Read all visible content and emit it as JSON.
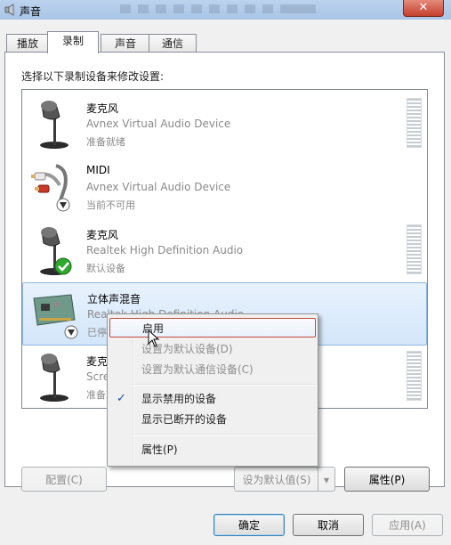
{
  "window": {
    "title": "声音",
    "close_glyph": "✕",
    "colors": {
      "title_bar": "#bcd3ee",
      "close_button": "#c4402d",
      "selection": "#d3e6fa",
      "menu_hover_border": "#c64a3a"
    }
  },
  "tabs": [
    {
      "label": "播放",
      "active": false
    },
    {
      "label": "录制",
      "active": true
    },
    {
      "label": "声音",
      "active": false
    },
    {
      "label": "通信",
      "active": false
    }
  ],
  "instruction": "选择以下录制设备来修改设置:",
  "devices": [
    {
      "name": "麦克风",
      "description": "Avnex Virtual Audio Device",
      "status": "准备就绪",
      "icon": "microphone-icon",
      "badge": ""
    },
    {
      "name": "MIDI",
      "description": "Avnex Virtual Audio Device",
      "status": "当前不可用",
      "icon": "audio-jack-icon",
      "badge": "down-arrow-badge"
    },
    {
      "name": "麦克风",
      "description": "Realtek High Definition Audio",
      "status": "默认设备",
      "icon": "microphone-icon",
      "badge": "default-check-badge"
    },
    {
      "name": "立体声混音",
      "description": "Realtek High Definition Audio",
      "status": "已停用",
      "icon": "sound-card-icon",
      "badge": "down-arrow-badge"
    },
    {
      "name": "麦克风",
      "description": "Screen Capture Audio",
      "status": "准备就绪",
      "icon": "microphone-icon",
      "badge": ""
    }
  ],
  "context_menu": {
    "items": [
      {
        "label": "启用",
        "enabled": true,
        "hover": true
      },
      {
        "label": "设置为默认设备(D)",
        "enabled": false
      },
      {
        "label": "设置为默认通信设备(C)",
        "enabled": false
      },
      {
        "label": "显示禁用的设备",
        "enabled": true,
        "checked": true
      },
      {
        "label": "显示已断开的设备",
        "enabled": true
      },
      {
        "label": "属性(P)",
        "enabled": true
      }
    ],
    "check_glyph": "✓"
  },
  "panel_buttons": {
    "configure": "配置(C)",
    "set_default": "设为默认值(S)",
    "dropdown_glyph": "▾",
    "properties": "属性(P)"
  },
  "dialog_buttons": {
    "ok": "确定",
    "cancel": "取消",
    "apply": "应用(A)"
  }
}
